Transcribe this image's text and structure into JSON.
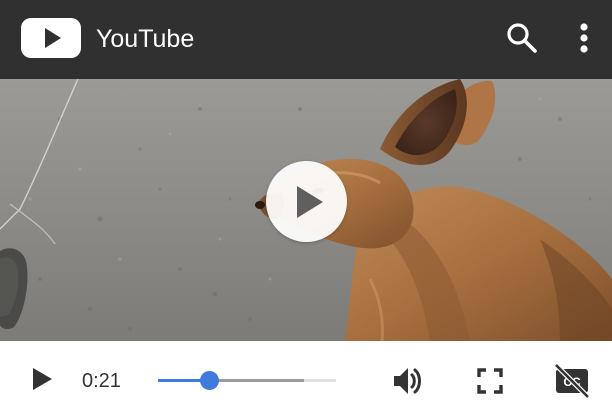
{
  "header": {
    "brand_name": "YouTube",
    "logo_icon": "youtube-logo-icon",
    "search_icon": "search-icon",
    "more_icon": "more-vert-icon",
    "background_color": "#303030"
  },
  "video": {
    "center_play_icon": "play-circle-icon",
    "content": "dog"
  },
  "controls": {
    "play_icon": "play-icon",
    "current_time": "0:21",
    "progress_fraction": 0.29,
    "buffered_fraction": 0.82,
    "accent_color": "#3e7bdc",
    "volume_icon": "volume-up-icon",
    "fullscreen_icon": "fullscreen-icon",
    "captions_icon": "closed-caption-off-icon"
  }
}
